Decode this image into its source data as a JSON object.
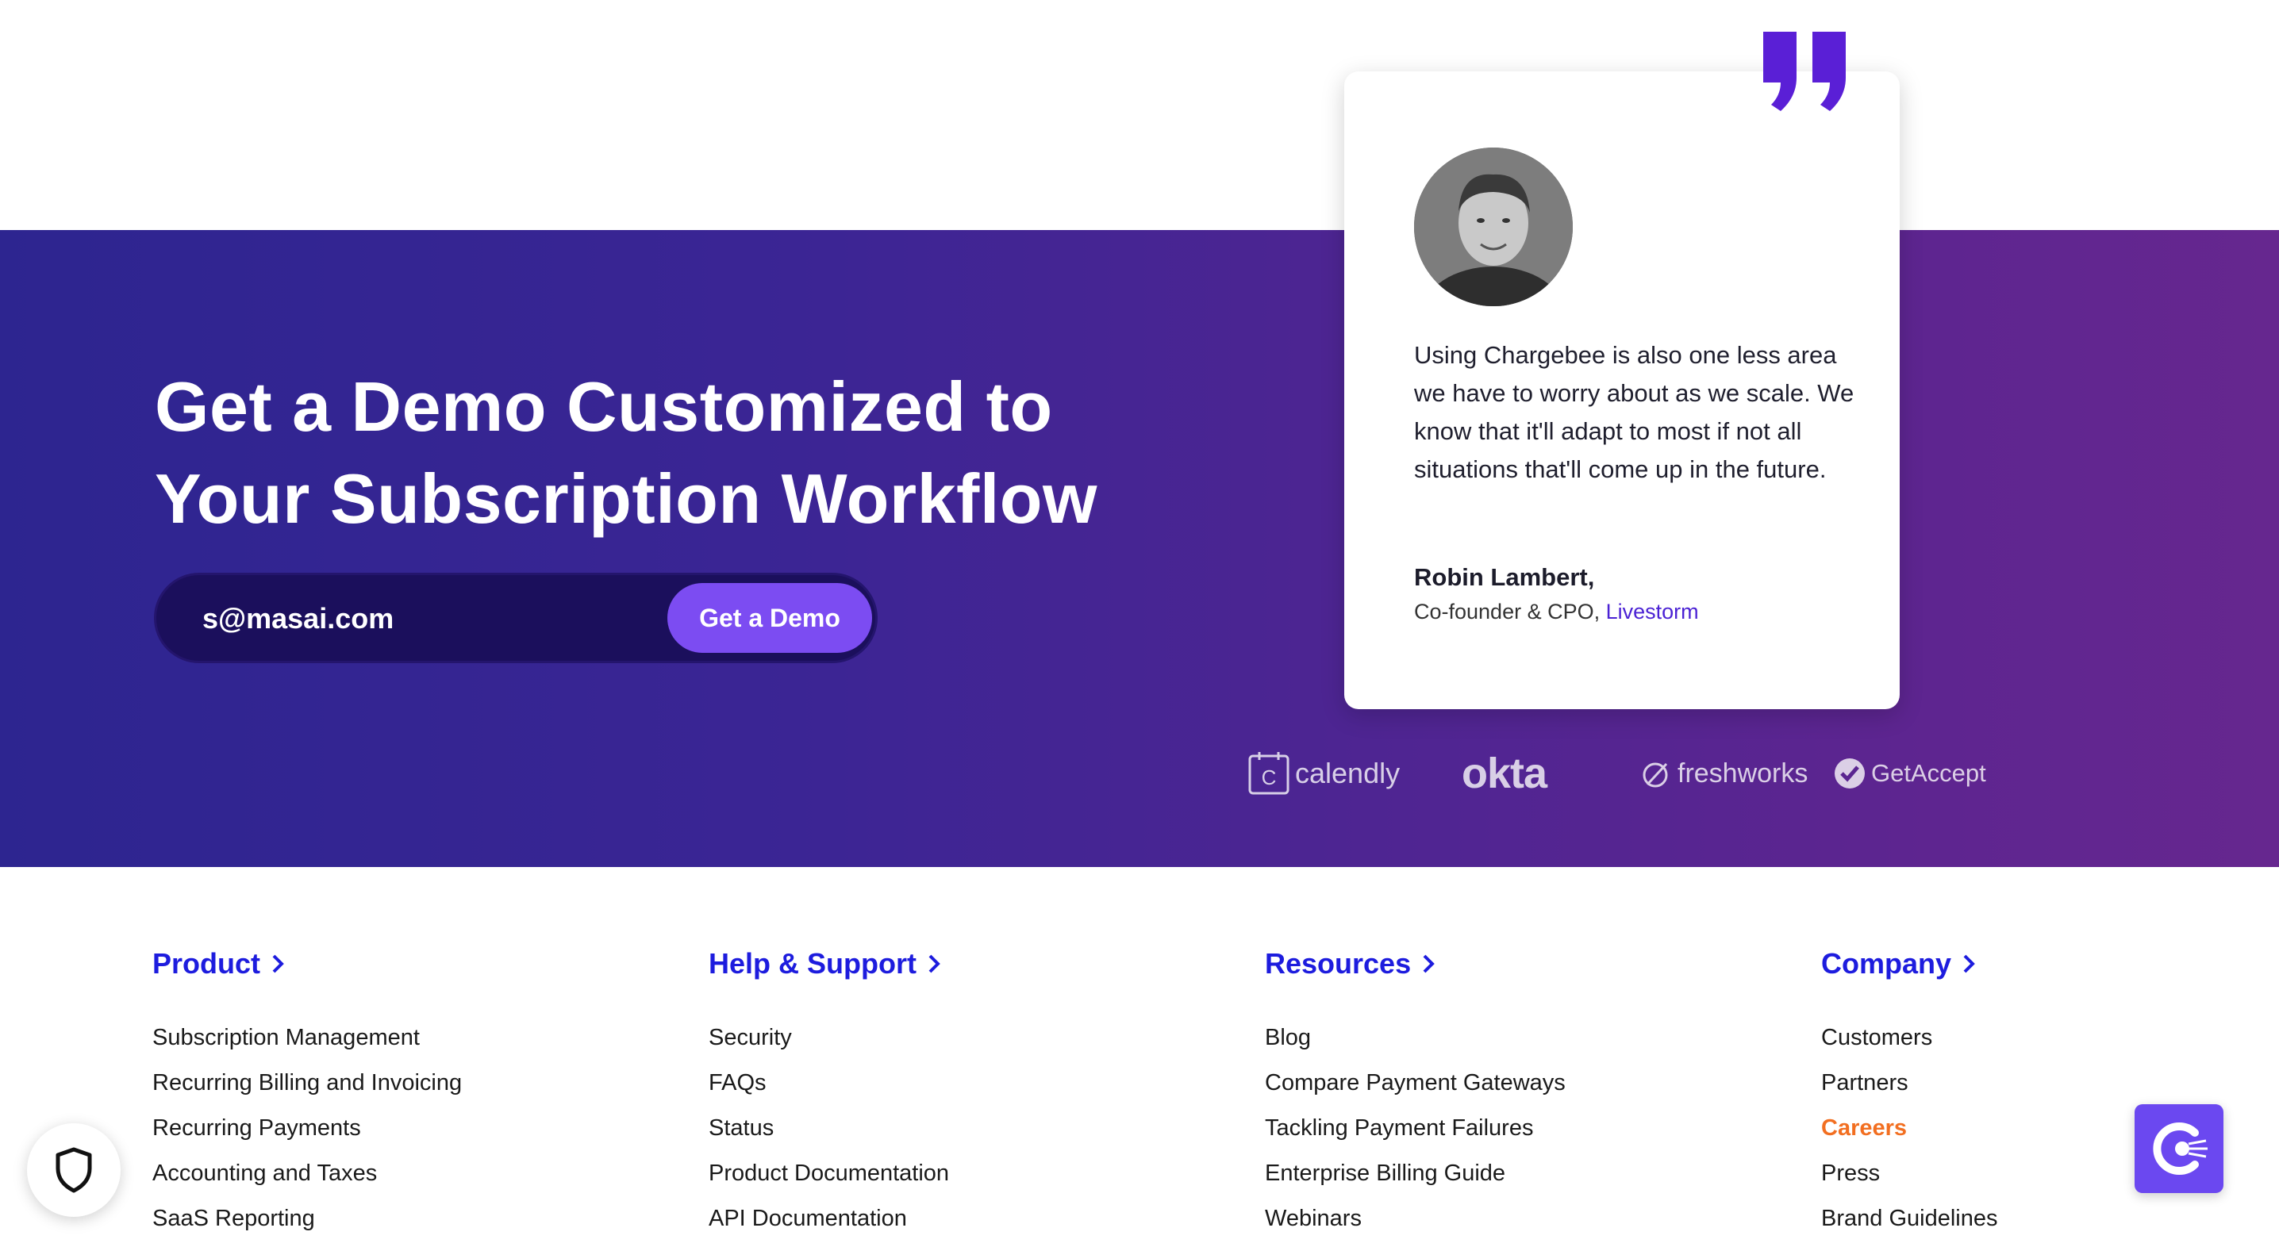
{
  "hero": {
    "title_line1": "Get a Demo Customized to",
    "title_line2": "Your Subscription Workflow",
    "email_value": "s@masai.com",
    "button_label": "Get a Demo"
  },
  "testimonial": {
    "quote": "Using Chargebee is also one less area we have to worry about as we scale. We know that it'll adapt to most if not all situations that'll come up in the future.",
    "name": "Robin Lambert,",
    "role": "Co-founder & CPO, ",
    "company": "Livestorm"
  },
  "logos": {
    "calendly": "calendly",
    "okta": "okta",
    "freshworks": "freshworks",
    "getaccept": "GetAccept"
  },
  "footer": {
    "columns": [
      {
        "heading": "Product",
        "items": [
          "Subscription Management",
          "Recurring Billing and Invoicing",
          "Recurring Payments",
          "Accounting and Taxes",
          "SaaS Reporting"
        ]
      },
      {
        "heading": "Help & Support",
        "items": [
          "Security",
          "FAQs",
          "Status",
          "Product Documentation",
          "API Documentation"
        ]
      },
      {
        "heading": "Resources",
        "items": [
          "Blog",
          "Compare Payment Gateways",
          "Tackling Payment Failures",
          "Enterprise Billing Guide",
          "Webinars"
        ]
      },
      {
        "heading": "Company",
        "items": [
          "Customers",
          "Partners",
          "Careers",
          "Press",
          "Brand Guidelines"
        ]
      }
    ]
  },
  "colors": {
    "hero_start": "#2d2590",
    "hero_end": "#66278f",
    "footer_heading": "#1d1cde",
    "highlight": "#f26f21",
    "button": "#7c4cf2",
    "quote_mark": "#5a1fd6"
  },
  "icons": {
    "quote": "quote-mark-icon",
    "shield": "shield-icon",
    "chat": "chargebee-chat-icon",
    "chevron": "chevron-right-icon"
  }
}
